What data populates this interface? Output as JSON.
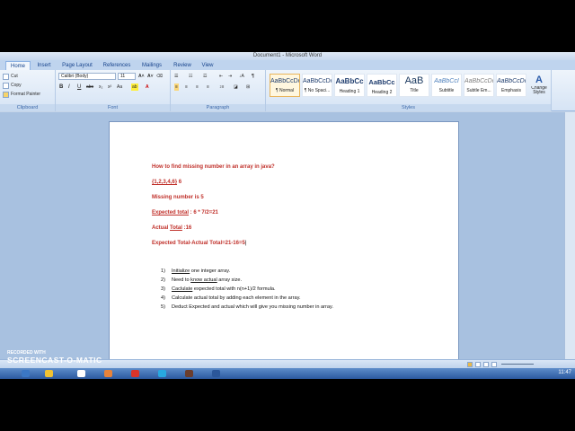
{
  "window": {
    "title": "Document1 - Microsoft Word"
  },
  "tabs": [
    "Home",
    "Insert",
    "Page Layout",
    "References",
    "Mailings",
    "Review",
    "View"
  ],
  "clipboard": {
    "cut": "Cut",
    "copy": "Copy",
    "format_painter": "Format Painter",
    "label": "Clipboard"
  },
  "font": {
    "family": "Calibri (Body)",
    "size": "11",
    "label": "Font"
  },
  "paragraph": {
    "label": "Paragraph"
  },
  "styles": {
    "label": "Styles",
    "tiles": [
      {
        "sample": "AaBbCcDc",
        "name": "¶ Normal"
      },
      {
        "sample": "AaBbCcDc",
        "name": "¶ No Spaci..."
      },
      {
        "sample": "AaBbCc",
        "name": "Heading 1"
      },
      {
        "sample": "AaBbCc",
        "name": "Heading 2"
      },
      {
        "sample": "AaB",
        "name": "Title"
      },
      {
        "sample": "AaBbCcI",
        "name": "Subtitle"
      },
      {
        "sample": "AaBbCcDc",
        "name": "Subtle Em..."
      },
      {
        "sample": "AaBbCcDc",
        "name": "Emphasis"
      }
    ],
    "change_styles": "Change Styles"
  },
  "document": {
    "heading": "How to find missing number in an array in java?",
    "array": "{1,2,3,4,6}",
    "array_suffix": " 6",
    "missing": "Missing number is 5",
    "expected_label": "Expected total",
    "expected_value": " : 6 * 7/2=21",
    "actual_prefix": "Actual ",
    "actual_label": "Total",
    "actual_value": " :16",
    "final": "Expected Total-Actual Total=21-16=5",
    "steps": [
      {
        "num": "1)",
        "pre": "",
        "u": "Initialize",
        "post": " one integer array."
      },
      {
        "num": "2)",
        "pre": "Need to ",
        "u": "know  actual",
        "post": " array size."
      },
      {
        "num": "3)",
        "pre": "",
        "u": "Caclulate",
        "post": " expected total with n(n+1)/2 formula."
      },
      {
        "num": "4)",
        "pre": "Calculate actual total by adding each element in the array.",
        "u": "",
        "post": ""
      },
      {
        "num": "5)",
        "pre": "Deduct Expected and actual  which will give you missing number in array.",
        "u": "",
        "post": ""
      }
    ]
  },
  "watermark": {
    "line1": "RECORDED WITH",
    "line2": "SCREENCAST-O-MATIC"
  },
  "taskbar": {
    "clock": "11:47"
  },
  "colors": {
    "accent_text": "#c0302a",
    "ribbon_blue": "#1e395b",
    "taskbar": "#2c5aa0"
  }
}
